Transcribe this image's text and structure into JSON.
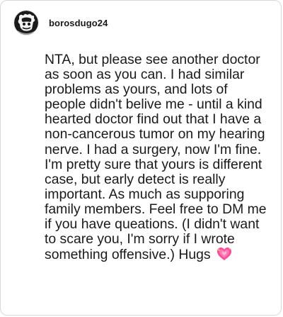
{
  "post": {
    "username": "borosdugo24",
    "body": "NTA, but please see another doctor as soon as you can. I had similar problems as yours, and lots of people didn't belive me - until a kind hearted doctor find out that I have a non-cancerous tumor on my hearing nerve. I had a surgery, now I'm fine. I'm pretty sure that yours is different case, but early detect is really important. As much as supporing family members. Feel free to DM me if you have queations. (I didn't want to scare you, I'm sorry if I wrote something offensive.) Hugs",
    "emoji": "sparkling-heart-icon"
  },
  "colors": {
    "border": "#d9d9d9",
    "text": "#1a1a1a",
    "heart": "#ff4f9a",
    "avatar_bg": "#1b1b1b"
  }
}
